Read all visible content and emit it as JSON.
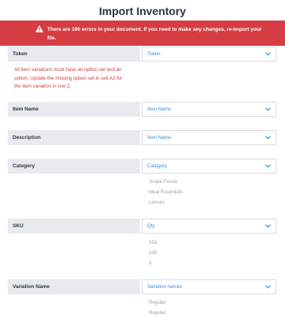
{
  "header": {
    "title": "Import Inventory"
  },
  "banner": {
    "message": "There are 100 errors in your document. If you need to make any changes, re-import your file."
  },
  "mapping_rows": [
    {
      "label": "Token",
      "selected": "Token"
    },
    {
      "label": "Item Name",
      "selected": "Item Name"
    },
    {
      "label": "Description",
      "selected": "Item Name"
    },
    {
      "label": "Category",
      "selected": "Category"
    },
    {
      "label": "SKU",
      "selected": "Qty"
    },
    {
      "label": "Variation Name",
      "selected": "Variation names"
    }
  ],
  "token_error": "All item variations must have an option set and an option. Update the missing option set in cell A2 for the item variation in row 2.",
  "category_samples": [
    "Snack Foods",
    "Meal Essentials",
    "Lenses"
  ],
  "sku_samples": [
    "353",
    "108",
    "3"
  ],
  "variation_samples": [
    "Regular",
    "Regular"
  ],
  "colors": {
    "error_red": "#d63d42",
    "link_blue": "#3b8fd9",
    "label_bg": "#e8eaee"
  },
  "icons": {
    "banner": "warning-icon",
    "select": "chevron-down-icon"
  }
}
